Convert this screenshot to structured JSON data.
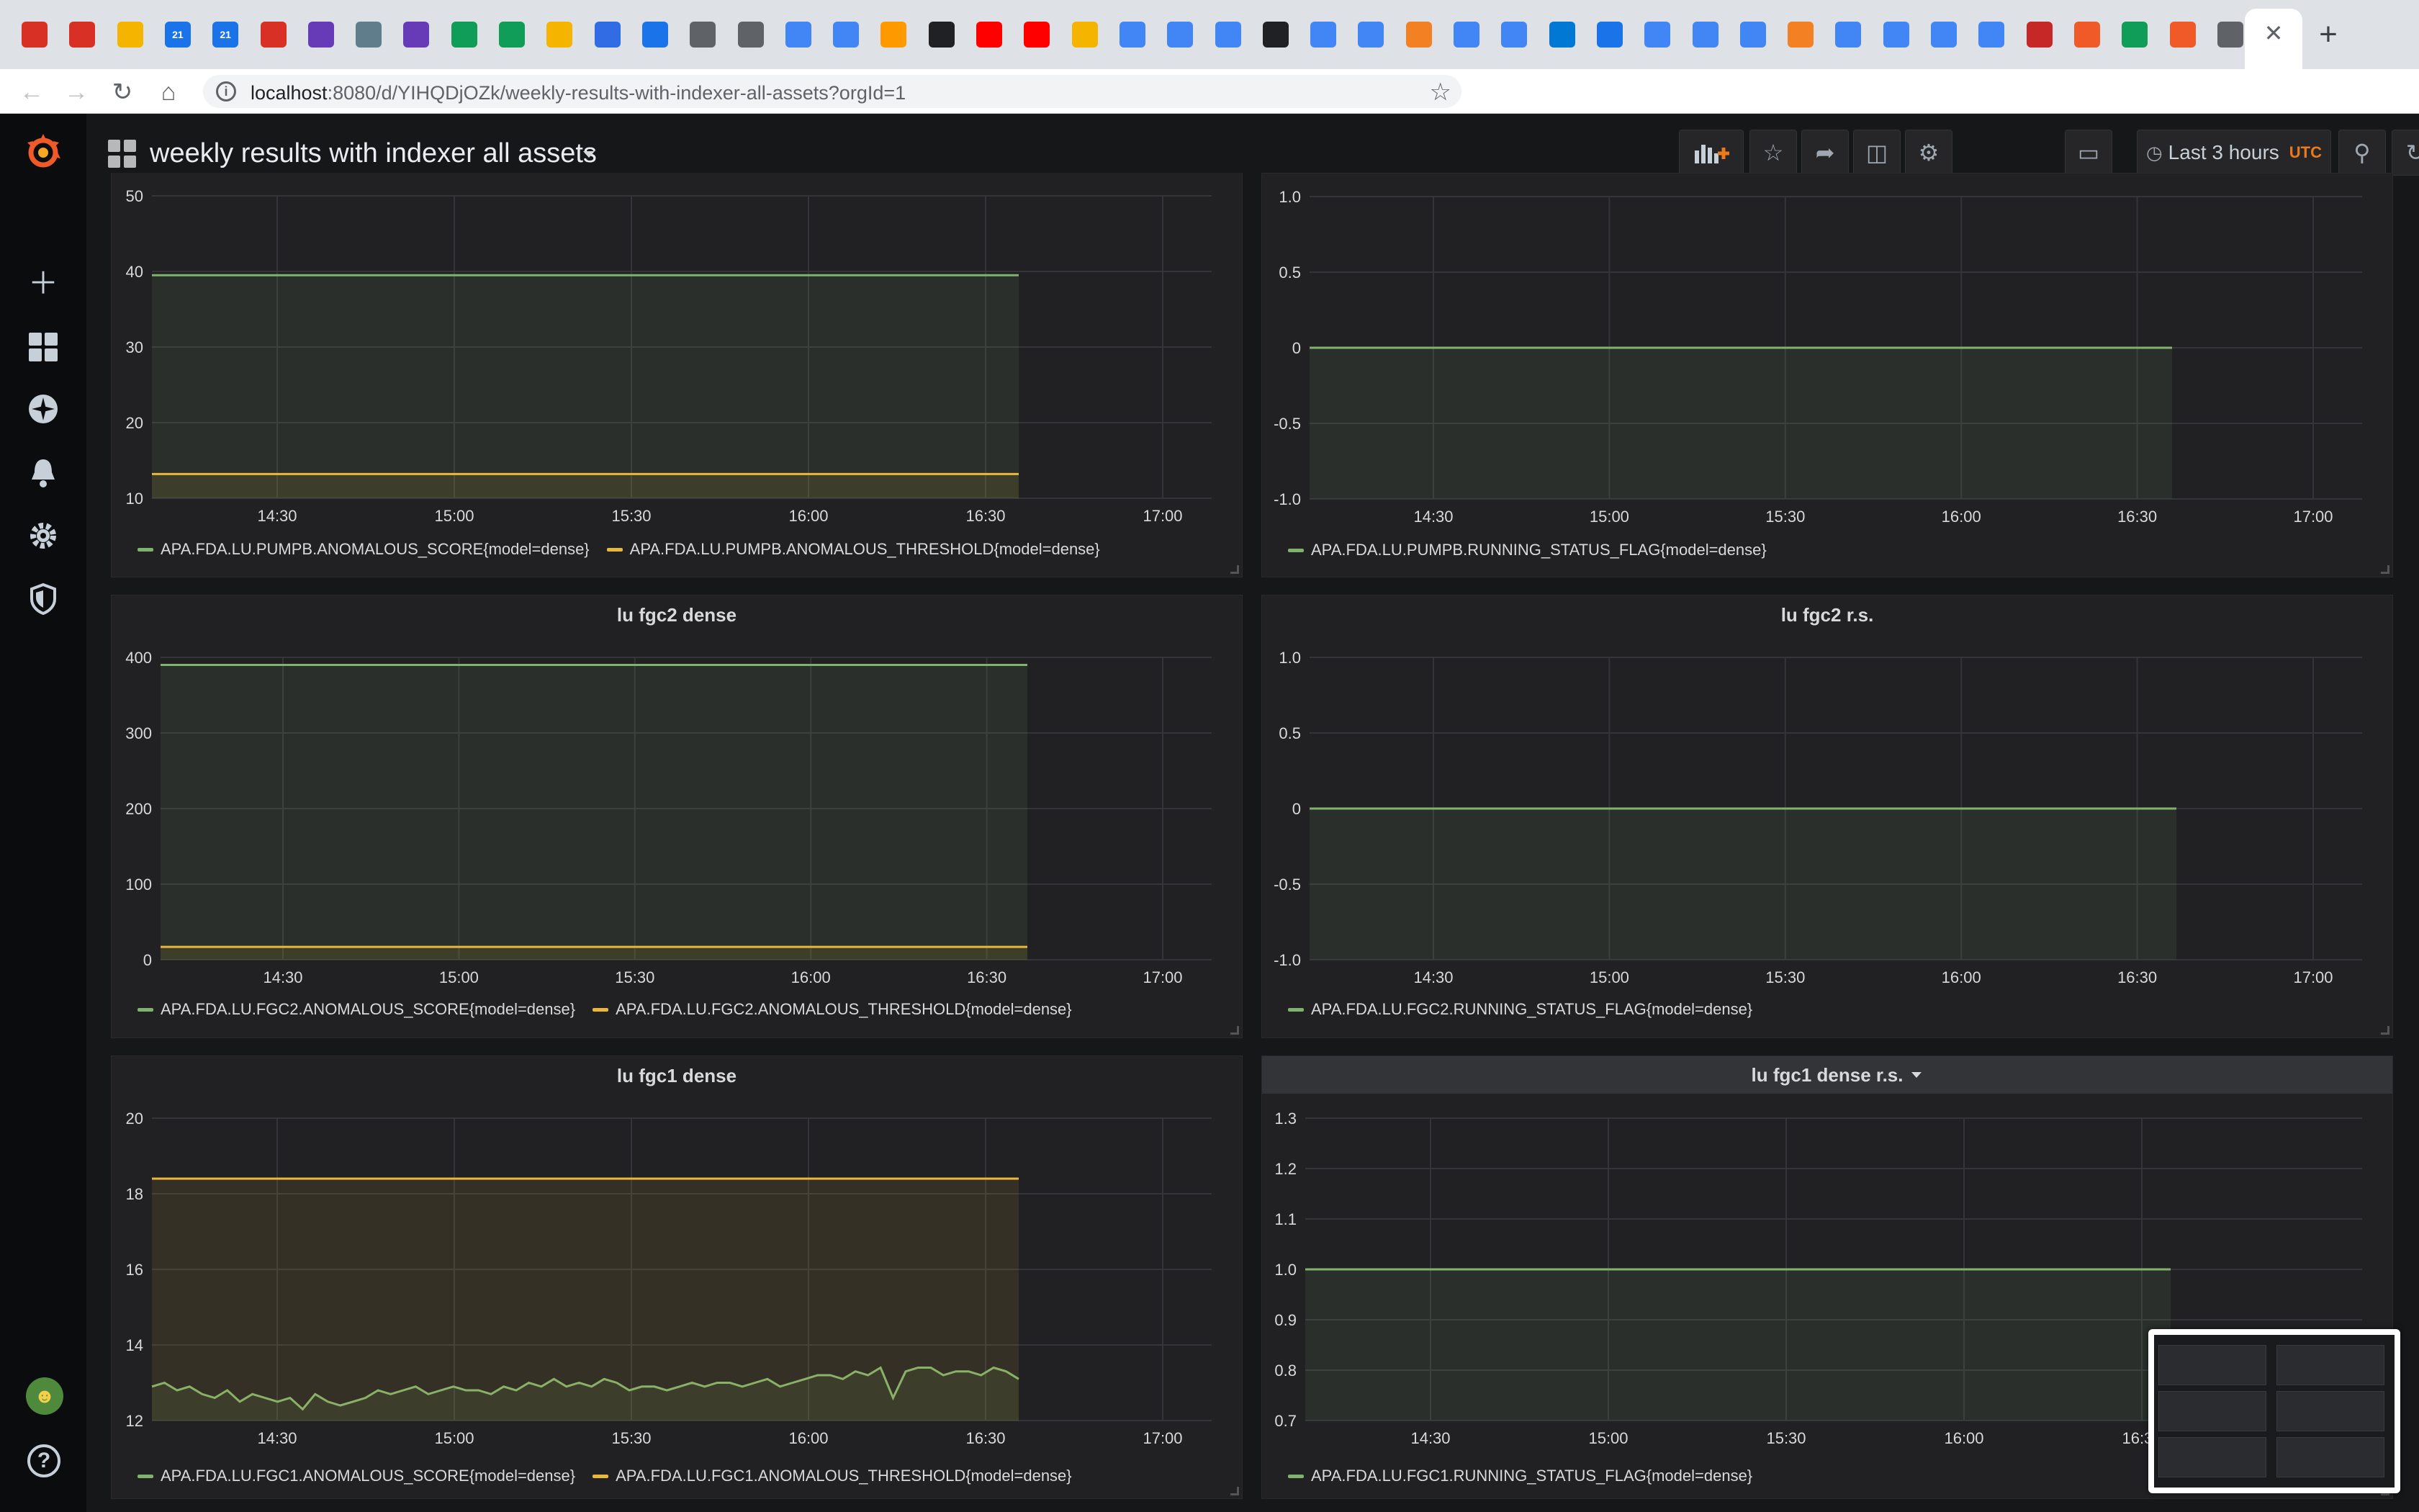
{
  "browser": {
    "url_host": "localhost",
    "url_rest": ":8080/d/YIHQDjOZk/weekly-results-with-indexer-all-assets?orgId=1",
    "tab_close": "✕",
    "new_tab": "+",
    "calendar_day": "21",
    "icon_names": [
      "gmail-icon",
      "gmail-icon",
      "slides-icon",
      "calendar-icon",
      "calendar-icon",
      "gmail-icon",
      "forms-icon",
      "bird-icon",
      "forms-icon",
      "airflow-icon",
      "airflow-icon",
      "slides-icon",
      "k8s-icon",
      "search-icon",
      "gear-icon",
      "gear-icon",
      "brain-icon",
      "brain-icon",
      "aws-icon",
      "clock-icon",
      "youtube-icon",
      "youtube-icon",
      "slides-icon",
      "code-icon",
      "google-icon",
      "google-icon",
      "github-icon",
      "docs-icon",
      "google-icon",
      "stackoverflow-icon",
      "cloud-icon",
      "google-icon",
      "azure-icon",
      "database-icon",
      "google-icon",
      "cloud-icon",
      "cloud-icon",
      "stackoverflow-icon",
      "google-icon",
      "cloud-icon",
      "cloud-icon",
      "google-icon",
      "jsc-icon",
      "grafana-icon",
      "sheets-icon",
      "grafana-icon",
      "globe-icon"
    ]
  },
  "navbar": {
    "title": "weekly results with indexer all assets",
    "time_range": "Last 3 hours",
    "timezone": "UTC"
  },
  "colors": {
    "green": "#7eb26d",
    "yellow": "#eab839",
    "grafana_orange": "#f05a28"
  },
  "panels": [
    {
      "id": "p1",
      "title": "",
      "chart_data": {
        "type": "line",
        "x_ticks": [
          "14:30",
          "15:00",
          "15:30",
          "16:00",
          "16:30",
          "17:00"
        ],
        "y_ticks": [
          "10",
          "20",
          "30",
          "40",
          "50"
        ],
        "ylim": [
          10,
          50
        ],
        "series": [
          {
            "name": "APA.FDA.LU.PUMPB.ANOMALOUS_SCORE{model=dense}",
            "color": "#7eb26d",
            "value": 39.5
          },
          {
            "name": "APA.FDA.LU.PUMPB.ANOMALOUS_THRESHOLD{model=dense}",
            "color": "#eab839",
            "value": 13.2
          }
        ]
      }
    },
    {
      "id": "p2",
      "title": "",
      "chart_data": {
        "type": "line",
        "x_ticks": [
          "14:30",
          "15:00",
          "15:30",
          "16:00",
          "16:30",
          "17:00"
        ],
        "y_ticks": [
          "-1.0",
          "-0.5",
          "0",
          "0.5",
          "1.0"
        ],
        "ylim": [
          -1,
          1
        ],
        "series": [
          {
            "name": "APA.FDA.LU.PUMPB.RUNNING_STATUS_FLAG{model=dense}",
            "color": "#7eb26d",
            "value": 0
          }
        ]
      }
    },
    {
      "id": "p3",
      "title": "lu fgc2 dense",
      "chart_data": {
        "type": "line",
        "x_ticks": [
          "14:30",
          "15:00",
          "15:30",
          "16:00",
          "16:30",
          "17:00"
        ],
        "y_ticks": [
          "0",
          "100",
          "200",
          "300",
          "400"
        ],
        "ylim": [
          0,
          400
        ],
        "series": [
          {
            "name": "APA.FDA.LU.FGC2.ANOMALOUS_SCORE{model=dense}",
            "color": "#7eb26d",
            "value": 390
          },
          {
            "name": "APA.FDA.LU.FGC2.ANOMALOUS_THRESHOLD{model=dense}",
            "color": "#eab839",
            "value": 17
          }
        ]
      }
    },
    {
      "id": "p4",
      "title": "lu fgc2 r.s.",
      "chart_data": {
        "type": "line",
        "x_ticks": [
          "14:30",
          "15:00",
          "15:30",
          "16:00",
          "16:30",
          "17:00"
        ],
        "y_ticks": [
          "-1.0",
          "-0.5",
          "0",
          "0.5",
          "1.0"
        ],
        "ylim": [
          -1,
          1
        ],
        "series": [
          {
            "name": "APA.FDA.LU.FGC2.RUNNING_STATUS_FLAG{model=dense}",
            "color": "#7eb26d",
            "value": 0
          }
        ]
      }
    },
    {
      "id": "p5",
      "title": "lu fgc1 dense",
      "chart_data": {
        "type": "line",
        "x_ticks": [
          "14:30",
          "15:00",
          "15:30",
          "16:00",
          "16:30",
          "17:00"
        ],
        "y_ticks": [
          "12",
          "14",
          "16",
          "18",
          "20"
        ],
        "ylim": [
          12,
          20
        ],
        "series": [
          {
            "name": "APA.FDA.LU.FGC1.ANOMALOUS_SCORE{model=dense}",
            "color": "#7eb26d",
            "values": [
              12.9,
              13.0,
              12.8,
              12.9,
              12.7,
              12.6,
              12.8,
              12.5,
              12.7,
              12.6,
              12.5,
              12.6,
              12.3,
              12.7,
              12.5,
              12.4,
              12.5,
              12.6,
              12.8,
              12.7,
              12.8,
              12.9,
              12.7,
              12.8,
              12.9,
              12.8,
              12.8,
              12.7,
              12.9,
              12.8,
              13.0,
              12.9,
              13.1,
              12.9,
              13.0,
              12.9,
              13.1,
              13.0,
              12.8,
              12.9,
              12.9,
              12.8,
              12.9,
              13.0,
              12.9,
              13.0,
              13.0,
              12.9,
              13.0,
              13.1,
              12.9,
              13.0,
              13.1,
              13.2,
              13.2,
              13.1,
              13.3,
              13.2,
              13.4,
              12.6,
              13.3,
              13.4,
              13.4,
              13.2,
              13.3,
              13.3,
              13.2,
              13.4,
              13.3,
              13.1
            ]
          },
          {
            "name": "APA.FDA.LU.FGC1.ANOMALOUS_THRESHOLD{model=dense}",
            "color": "#eab839",
            "value": 18.4
          }
        ]
      }
    },
    {
      "id": "p6",
      "title": "lu fgc1 dense r.s.",
      "chart_data": {
        "type": "line",
        "x_ticks": [
          "14:30",
          "15:00",
          "15:30",
          "16:00",
          "16:30"
        ],
        "y_ticks": [
          "0.7",
          "0.8",
          "0.9",
          "1.0",
          "1.1",
          "1.2",
          "1.3"
        ],
        "ylim": [
          0.7,
          1.3
        ],
        "series": [
          {
            "name": "APA.FDA.LU.FGC1.RUNNING_STATUS_FLAG{model=dense}",
            "color": "#7eb26d",
            "value": 1.0
          }
        ]
      }
    }
  ]
}
